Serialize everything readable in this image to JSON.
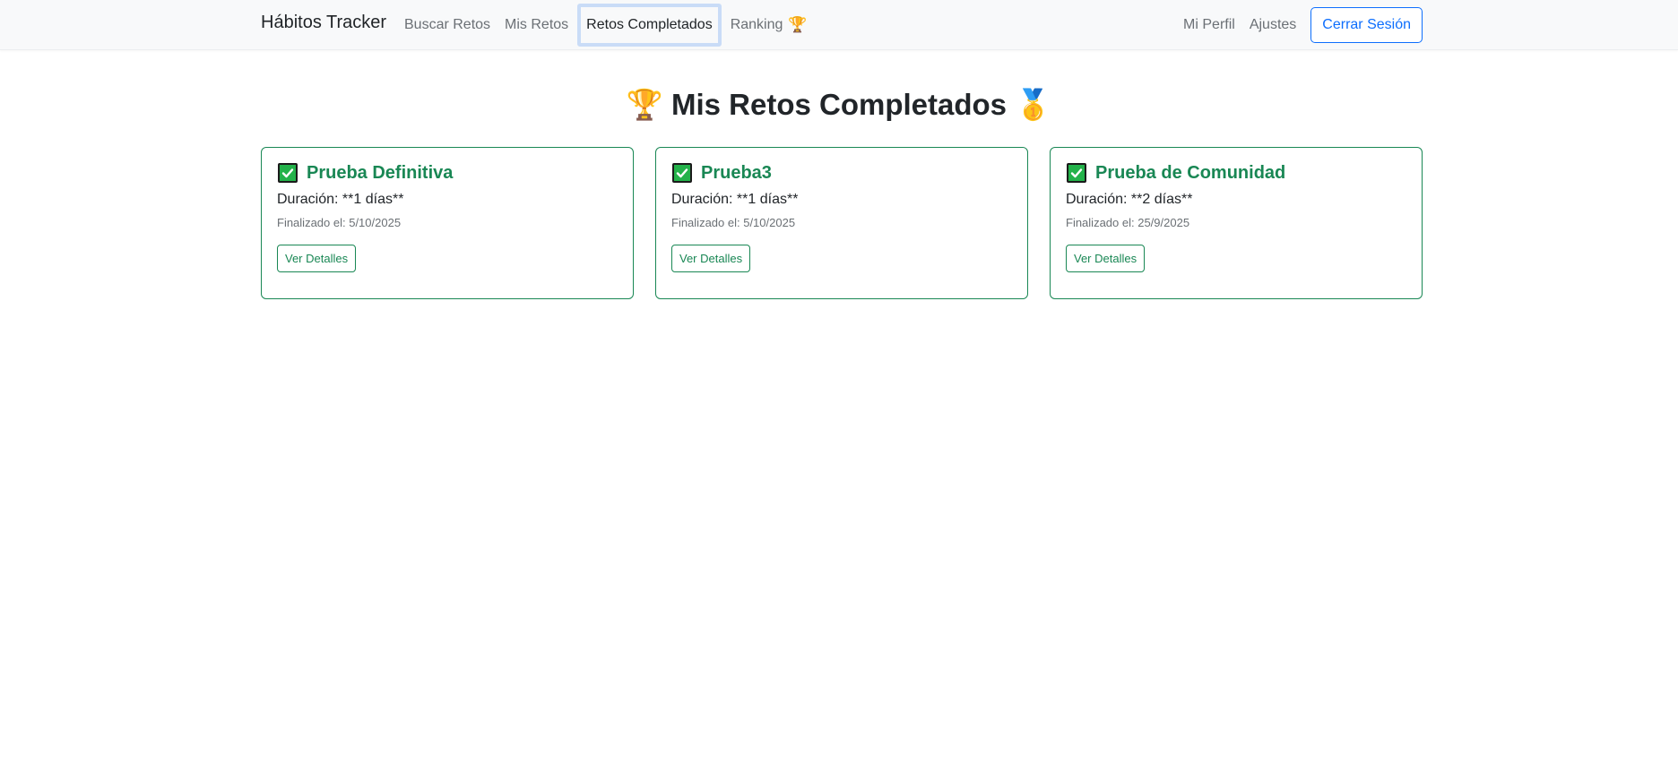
{
  "navbar": {
    "brand": "Hábitos Tracker",
    "links": [
      {
        "label": "Buscar Retos"
      },
      {
        "label": "Mis Retos"
      },
      {
        "label": "Retos Completados",
        "active": true
      },
      {
        "label": "Ranking",
        "icon": "trophy-icon"
      }
    ],
    "right_links": [
      {
        "label": "Mi Perfil"
      },
      {
        "label": "Ajustes"
      }
    ],
    "logout_label": "Cerrar Sesión"
  },
  "page": {
    "title": "Mis Retos Completados",
    "title_left_icon": "trophy-icon",
    "title_right_icon": "medal-icon"
  },
  "cards": [
    {
      "title": "Prueba Definitiva",
      "duration": "Duración: **1 días**",
      "finished": "Finalizado el: 5/10/2025",
      "button": "Ver Detalles"
    },
    {
      "title": "Prueba3",
      "duration": "Duración: **1 días**",
      "finished": "Finalizado el: 5/10/2025",
      "button": "Ver Detalles"
    },
    {
      "title": "Prueba de Comunidad",
      "duration": "Duración: **2 días**",
      "finished": "Finalizado el: 25/9/2025",
      "button": "Ver Detalles"
    }
  ],
  "colors": {
    "accent": "#198754",
    "primary": "#0d6efd",
    "navbar_bg": "#f8f9fa",
    "active_outline": "#c9dcf7"
  }
}
